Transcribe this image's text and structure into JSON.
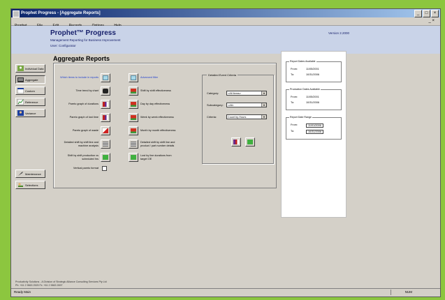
{
  "window": {
    "title": "Prophet Progress - [Aggregate Reports]"
  },
  "menu": [
    "Prophet",
    "File",
    "Edit",
    "Records",
    "Options",
    "Help"
  ],
  "header": {
    "logo": "Prophet™ Progress",
    "sub1": "Management Reporting for Business Improvement",
    "sub2": "User: Configurator",
    "version": "Version 2.2000"
  },
  "page_title": "Aggregate Reports",
  "nav": [
    {
      "label": "Individual Data",
      "icon": "person-icon"
    },
    {
      "label": "Aggregate",
      "icon": "folder-icon",
      "selected": true
    },
    {
      "label": "Custom",
      "icon": "chart-icon"
    },
    {
      "label": "Reference",
      "icon": "line-chart-icon"
    },
    {
      "label": "Variance",
      "icon": "group-icon"
    },
    {
      "label": "Maintenance",
      "icon": "wrench-icon"
    },
    {
      "label": "Selections",
      "icon": "person-list-icon"
    }
  ],
  "reports_left": [
    {
      "label": "Which items to include in reports",
      "icon": "list-icon",
      "link": true
    },
    {
      "label": "Time trend by chart",
      "icon": "camera-icon"
    },
    {
      "label": "Pareto graph of durations",
      "icon": "bar-icon"
    },
    {
      "label": "Pareto graph of lost time",
      "icon": "bar-icon"
    },
    {
      "label": "Pareto graph of waste",
      "icon": "area-icon"
    },
    {
      "label": "Detailed shift by shift line and machine analysis",
      "icon": "table-icon"
    },
    {
      "label": "Shift by shift production vs scheduled hrs",
      "icon": "green-chart-icon"
    },
    {
      "label": "Vertical pareto format",
      "icon": "checkbox"
    }
  ],
  "reports_right": [
    {
      "label": "Advanced filter",
      "icon": "list-icon",
      "link": true
    },
    {
      "label": "Shift by shift effectiveness",
      "icon": "bar-red-icon"
    },
    {
      "label": "Day by day effectiveness",
      "icon": "bar-red-icon"
    },
    {
      "label": "Week by week effectiveness",
      "icon": "bar-red-icon"
    },
    {
      "label": "Month by month effectiveness",
      "icon": "bar-red-icon"
    },
    {
      "label": "Detailed shift by shift line and product / part number details",
      "icon": "table-icon"
    },
    {
      "label": "Lost by line durations from target OE",
      "icon": "green-chart-icon"
    }
  ],
  "fieldset": {
    "legend": "Detailed Event Criteria",
    "rows": [
      {
        "label": "Category:",
        "value": "<All Items>"
      },
      {
        "label": "Subcategory:",
        "value": "<All>"
      },
      {
        "label": "Criteria:",
        "value": "Count by Hours"
      }
    ]
  },
  "info_panel": [
    {
      "legend": "Report Dates Available",
      "rows": [
        {
          "k": "From:",
          "v": "11/05/2001"
        },
        {
          "k": "To:",
          "v": "10/31/2006"
        }
      ]
    },
    {
      "legend": "Production Dates Available",
      "rows": [
        {
          "k": "From:",
          "v": "11/05/2001"
        },
        {
          "k": "To:",
          "v": "10/31/2006"
        }
      ]
    },
    {
      "legend": "Report Date Range",
      "rows": [
        {
          "k": "From:",
          "v": "11/01/2006"
        },
        {
          "k": "To:",
          "v": "10/31/2006"
        }
      ]
    }
  ],
  "footer": {
    "line1": "Productivity Solutions - A Division of Strategic Alliance Consulting Services Pty Ltd",
    "line2": "Ph: +61 2 9663 2525   Fx: +61 2 9663 2697"
  },
  "status": {
    "left": "Ready  Main",
    "right": "NUM"
  },
  "colors": {
    "frame": "#8cc63f",
    "header_bg": "#c9d3e8",
    "link": "#1f3fd0"
  }
}
